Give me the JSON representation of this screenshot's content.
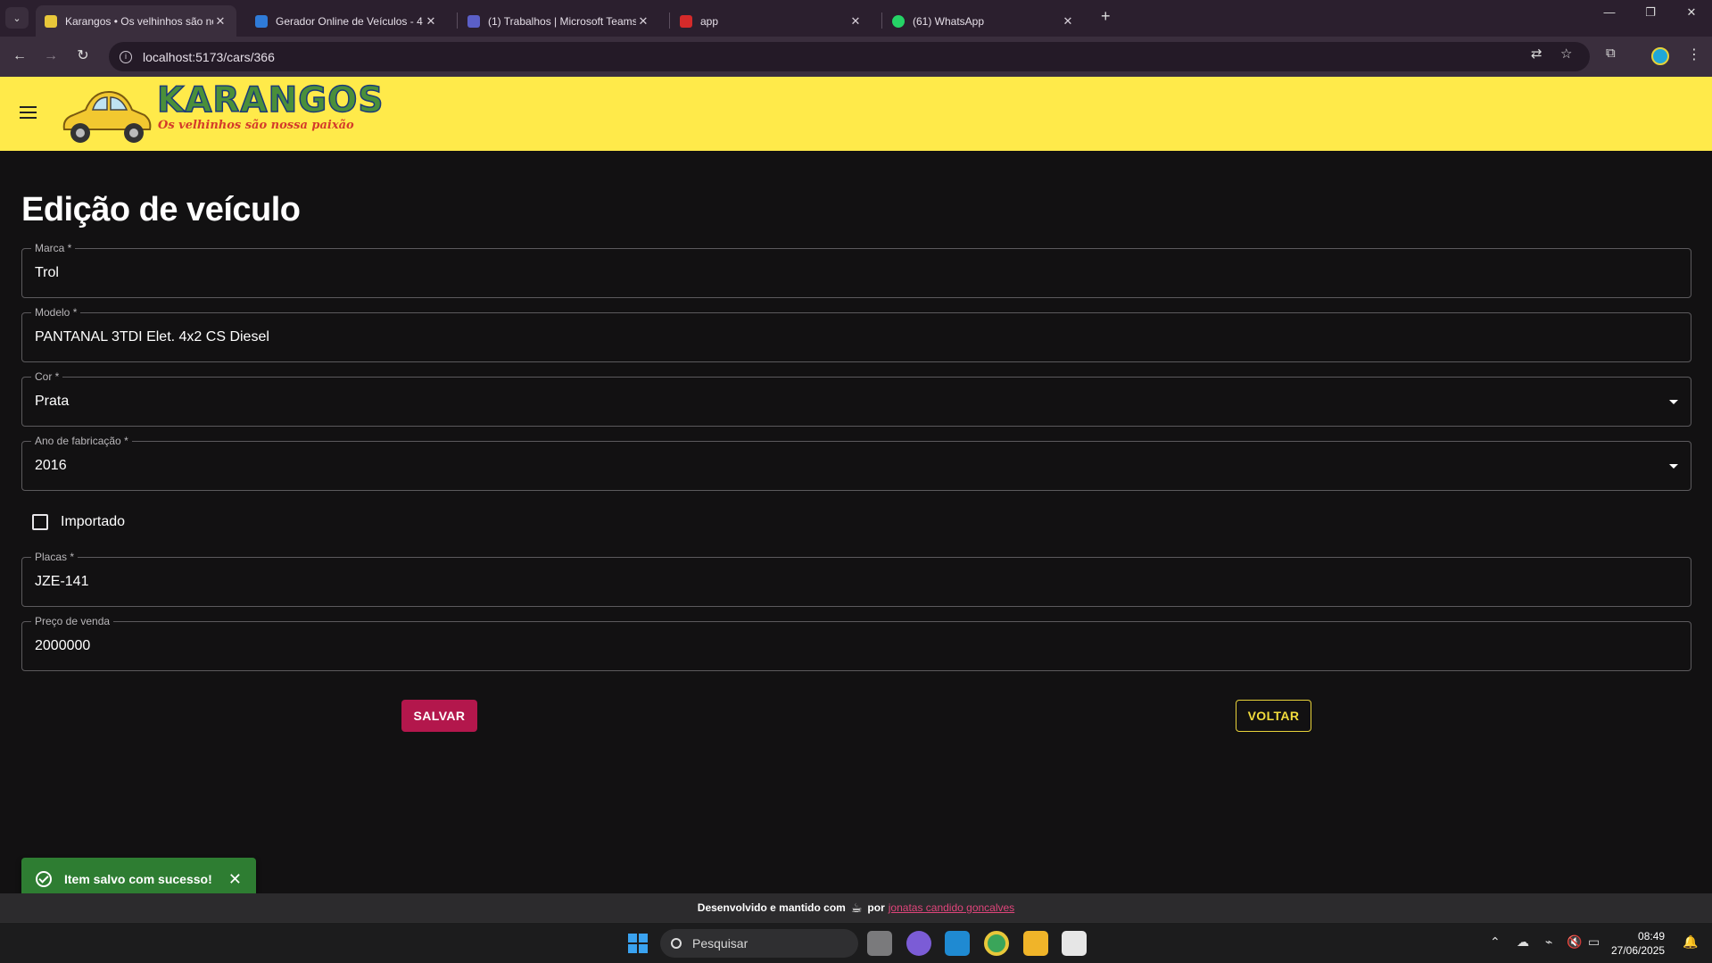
{
  "browser": {
    "tabs": [
      {
        "title": "Karangos • Os velhinhos são no",
        "active": true
      },
      {
        "title": "Gerador Online de Veículos - 4",
        "active": false
      },
      {
        "title": "(1) Trabalhos | Microsoft Teams",
        "active": false
      },
      {
        "title": "app",
        "active": false
      },
      {
        "title": "(61) WhatsApp",
        "active": false
      }
    ],
    "url": "localhost:5173/cars/366"
  },
  "header": {
    "logo_text": "KARANGOS",
    "tagline": "Os velhinhos são nossa paixão"
  },
  "main": {
    "title": "Edição de veículo",
    "fields": {
      "marca": {
        "label": "Marca *",
        "value": "Trol"
      },
      "modelo": {
        "label": "Modelo *",
        "value": "PANTANAL 3TDI Elet. 4x2 CS Diesel"
      },
      "cor": {
        "label": "Cor *",
        "value": "Prata"
      },
      "ano": {
        "label": "Ano de fabricação *",
        "value": "2016"
      },
      "placas": {
        "label": "Placas *",
        "value": "JZE-141"
      },
      "preco": {
        "label": "Preço de venda",
        "value": "2000000"
      }
    },
    "importado": {
      "label": "Importado",
      "checked": false
    },
    "save_label": "SALVAR",
    "back_label": "VOLTAR"
  },
  "snackbar": {
    "message": "Item salvo com sucesso!"
  },
  "footer": {
    "text_before": "Desenvolvido e mantido com",
    "text_by": "por",
    "author": "jonatas candido goncalves"
  },
  "taskbar": {
    "search_placeholder": "Pesquisar",
    "time": "08:49",
    "date": "27/06/2025"
  },
  "colors": {
    "appbar": "#ffea4a",
    "save_button": "#b3174c",
    "back_button_accent": "#f2dc3c",
    "snackbar": "#2e7d32",
    "author_link": "#e0457b"
  }
}
